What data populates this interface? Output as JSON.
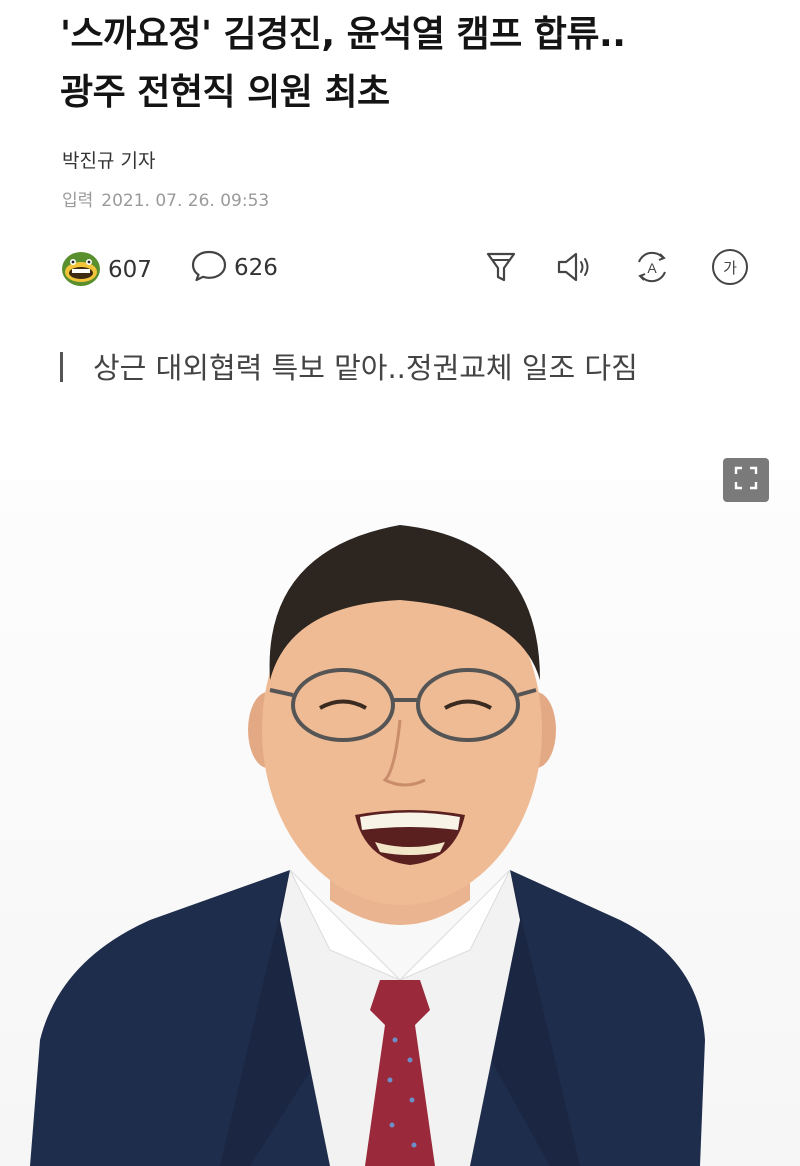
{
  "article": {
    "headline_line1": "'스까요정' 김경진, 윤석열 캠프 합류..",
    "headline_line2": "광주 전현직 의원 최초",
    "reporter": "박진규 기자",
    "date_label": "입력",
    "date_value": "2021. 07. 26. 09:53",
    "subheadline": "상근 대외협력 특보 맡아..정권교체 일조 다짐"
  },
  "actions": {
    "reaction_count": "607",
    "comment_count": "626",
    "font_size_glyph": "가",
    "translate_glyph": "A"
  },
  "icons": {
    "reaction": "green-emoji-icon",
    "comment": "speech-bubble-icon",
    "filter": "funnel-icon",
    "audio": "speaker-icon",
    "translate": "translate-icon",
    "font_size": "font-size-icon",
    "expand": "fullscreen-icon"
  },
  "colors": {
    "emoji_green": "#5a8f2e",
    "emoji_yellow": "#f2c43a",
    "suit_navy": "#1f2d4c",
    "tie_red": "#9a2a3b"
  }
}
